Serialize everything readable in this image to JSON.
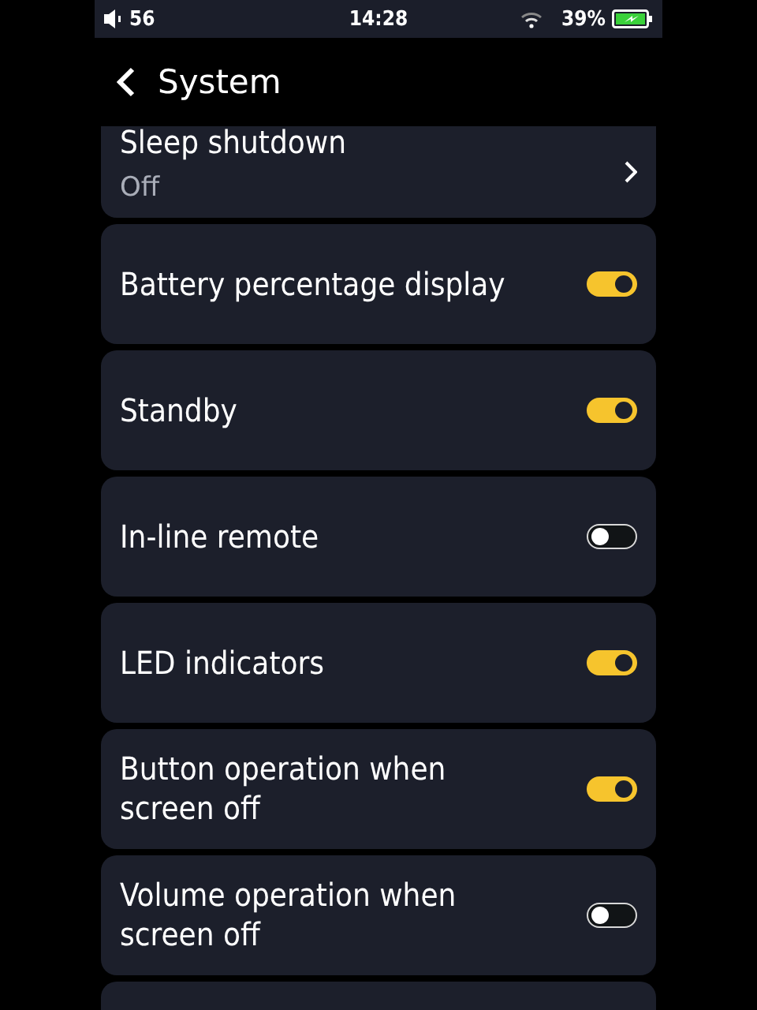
{
  "status_bar": {
    "volume": "56",
    "time": "14:28",
    "battery": "39%"
  },
  "header": {
    "title": "System"
  },
  "settings": [
    {
      "kind": "link",
      "label": "Sleep shutdown",
      "value": "Off"
    },
    {
      "kind": "toggle",
      "label": "Battery percentage display",
      "on": true
    },
    {
      "kind": "toggle",
      "label": "Standby",
      "on": true
    },
    {
      "kind": "toggle",
      "label": "In-line remote",
      "on": false
    },
    {
      "kind": "toggle",
      "label": "LED indicators",
      "on": true
    },
    {
      "kind": "toggle",
      "label": "Button operation when screen off",
      "on": true
    },
    {
      "kind": "toggle",
      "label": "Volume operation when screen off",
      "on": false
    },
    {
      "kind": "blank"
    }
  ]
}
